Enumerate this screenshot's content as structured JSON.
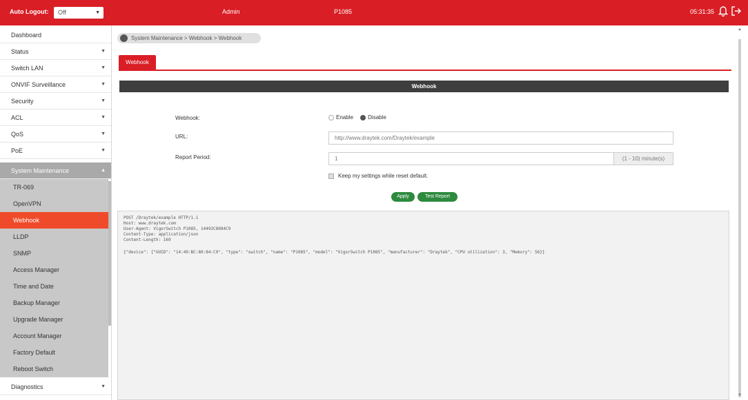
{
  "topbar": {
    "auto_logout_label": "Auto Logout:",
    "auto_logout_value": "Off",
    "user": "Admin",
    "model": "P1085",
    "time": "05:31:35"
  },
  "sidebar": {
    "items": [
      {
        "label": "Dashboard"
      },
      {
        "label": "Status"
      },
      {
        "label": "Switch LAN"
      },
      {
        "label": "ONVIF Surveillance"
      },
      {
        "label": "Security"
      },
      {
        "label": "ACL"
      },
      {
        "label": "QoS"
      },
      {
        "label": "PoE"
      },
      {
        "label": "System Maintenance"
      }
    ],
    "subitems": [
      {
        "label": "TR-069"
      },
      {
        "label": "OpenVPN"
      },
      {
        "label": "Webhook"
      },
      {
        "label": "LLDP"
      },
      {
        "label": "SNMP"
      },
      {
        "label": "Access Manager"
      },
      {
        "label": "Time and Date"
      },
      {
        "label": "Backup Manager"
      },
      {
        "label": "Upgrade Manager"
      },
      {
        "label": "Account Manager"
      },
      {
        "label": "Factory Default"
      },
      {
        "label": "Reboot Switch"
      }
    ],
    "bottom_item": {
      "label": "Diagnostics"
    }
  },
  "breadcrumb": "System Maintenance > Webhook > Webhook",
  "tab": {
    "label": "Webhook"
  },
  "section_title": "Webhook",
  "form": {
    "webhook_label": "Webhook:",
    "enable_label": "Enable",
    "disable_label": "Disable",
    "url_label": "URL:",
    "url_value": "http://www.draytek.com/Draytek/example",
    "period_label": "Report Period:",
    "period_value": "1",
    "period_unit": "(1 - 10) minute(s)",
    "keep_label": "Keep my settings while reset default.",
    "apply_label": "Apply",
    "test_label": "Test Report"
  },
  "code": {
    "lines": [
      "POST /Draytek/example HTTP/1.1",
      "Host: www.draytek.com",
      "User-Agent: VigorSwitch P1085, 14493C8084C9",
      "Content-Type: application/json",
      "Content-Length: 169"
    ],
    "json": "{\"device\": {\"UUID\": \"14:49:BC:80:84:C9\", \"type\": \"switch\", \"name\": \"P1085\", \"model\": \"VigorSwitch P1085\", \"manufacturer\": \"Draytek\", \"CPU utilization\": 3, \"Memory\": 56}}"
  },
  "colors": {
    "brand": "#d91e25",
    "active_menu": "#ef4b2b",
    "button": "#2d8a3e"
  }
}
